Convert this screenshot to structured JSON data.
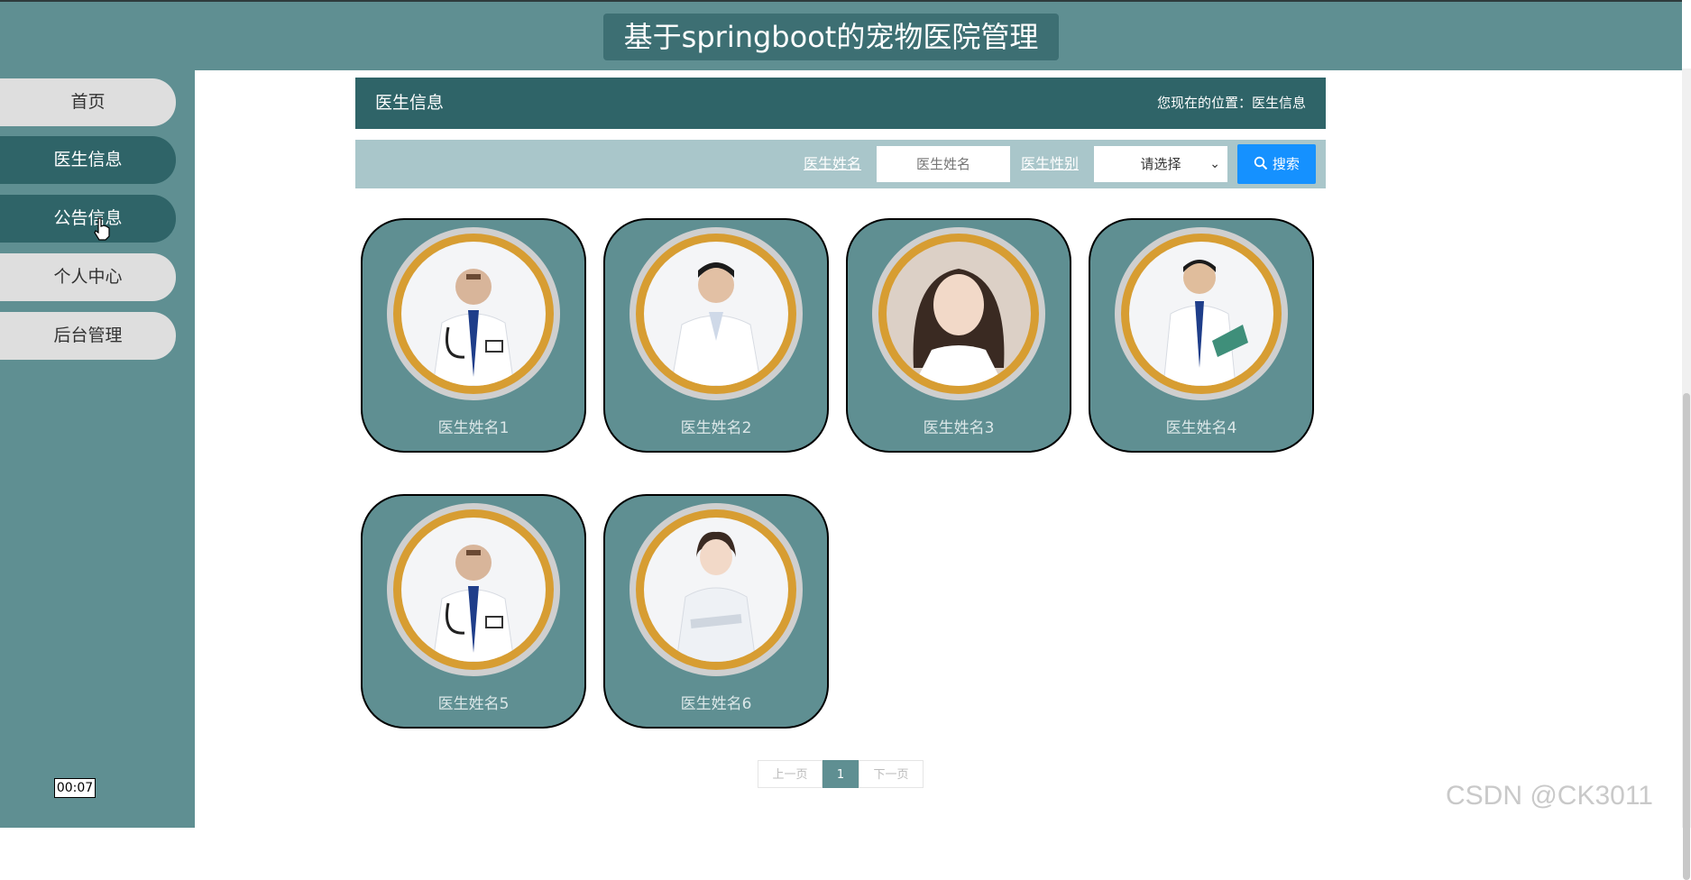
{
  "site": {
    "title": "基于springboot的宠物医院管理"
  },
  "sidebar": {
    "items": [
      {
        "label": "首页"
      },
      {
        "label": "医生信息"
      },
      {
        "label": "公告信息"
      },
      {
        "label": "个人中心"
      },
      {
        "label": "后台管理"
      }
    ]
  },
  "page": {
    "title": "医生信息",
    "location_label": "您现在的位置：医生信息"
  },
  "search": {
    "name_label": "医生姓名",
    "name_placeholder": "医生姓名",
    "gender_label": "医生性别",
    "gender_selected": "请选择",
    "button_label": "搜索"
  },
  "doctors": [
    {
      "name": "医生姓名1"
    },
    {
      "name": "医生姓名2"
    },
    {
      "name": "医生姓名3"
    },
    {
      "name": "医生姓名4"
    },
    {
      "name": "医生姓名5"
    },
    {
      "name": "医生姓名6"
    }
  ],
  "pagination": {
    "prev": "上一页",
    "current": "1",
    "next": "下一页"
  },
  "overlay": {
    "timer": "00:07",
    "watermark": "CSDN @CK3011"
  },
  "colors": {
    "header": "#5f8f92",
    "dark": "#2f6468",
    "accent": "#1591ff",
    "ring": "#d79d32"
  }
}
